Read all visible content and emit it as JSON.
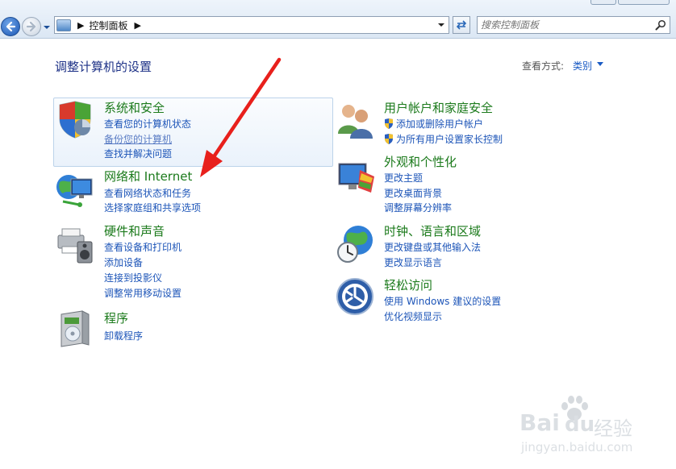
{
  "address": {
    "path": "控制面板"
  },
  "search": {
    "placeholder": "搜索控制面板"
  },
  "header": {
    "title": "调整计算机的设置",
    "view_label": "查看方式:",
    "view_value": "类别"
  },
  "categories": [
    {
      "id": "system-security",
      "title": "系统和安全",
      "links": [
        "查看您的计算机状态",
        "备份您的计算机",
        "查找并解决问题"
      ]
    },
    {
      "id": "network-internet",
      "title": "网络和 Internet",
      "links": [
        "查看网络状态和任务",
        "选择家庭组和共享选项"
      ]
    },
    {
      "id": "hardware-sound",
      "title": "硬件和声音",
      "links": [
        "查看设备和打印机",
        "添加设备",
        "连接到投影仪",
        "调整常用移动设置"
      ]
    },
    {
      "id": "programs",
      "title": "程序",
      "links": [
        "卸载程序"
      ]
    },
    {
      "id": "user-accounts",
      "title": "用户帐户和家庭安全",
      "links": [
        "添加或删除用户帐户",
        "为所有用户设置家长控制"
      ]
    },
    {
      "id": "appearance",
      "title": "外观和个性化",
      "links": [
        "更改主题",
        "更改桌面背景",
        "调整屏幕分辨率"
      ]
    },
    {
      "id": "clock-language",
      "title": "时钟、语言和区域",
      "links": [
        "更改键盘或其他输入法",
        "更改显示语言"
      ]
    },
    {
      "id": "ease-of-access",
      "title": "轻松访问",
      "links": [
        "使用 Windows 建议的设置",
        "优化视频显示"
      ]
    }
  ],
  "watermark": {
    "brand": "Bai",
    "brand2": "du",
    "cn": "经验",
    "url": "jingyan.baidu.com"
  },
  "colors": {
    "category_title": "#1b7a1b",
    "link": "#1d55b8",
    "annotation_arrow": "#e8201c"
  }
}
